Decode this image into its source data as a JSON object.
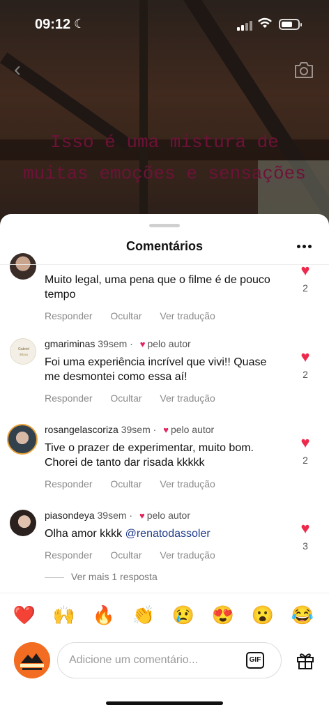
{
  "status_bar": {
    "time": "09:12",
    "moon": "☾"
  },
  "overlay_text": "Isso é uma mistura de muitas emoções e sensações",
  "sheet": {
    "title": "Comentários"
  },
  "comments": [
    {
      "username": "",
      "time": "",
      "author_label": "",
      "text": "Muito legal, uma pena que o filme é de pouco tempo",
      "likes": "2"
    },
    {
      "username": "gmariminas",
      "time": "39sem",
      "author_label": "pelo autor",
      "text": "Foi uma experiência incrível que vivi!! Quase me desmontei como essa aí!",
      "likes": "2"
    },
    {
      "username": "rosangelascoriza",
      "time": "39sem",
      "author_label": "pelo autor",
      "text": "Tive o prazer de experimentar,  muito bom. Chorei de tanto dar risada kkkkk",
      "likes": "2"
    },
    {
      "username": "piasondeya",
      "time": "39sem",
      "author_label": "pelo autor",
      "text": "Olha amor kkkk ",
      "mention": "@renatodassoler",
      "likes": "3"
    }
  ],
  "actions": {
    "reply": "Responder",
    "hide": "Ocultar",
    "translate": "Ver tradução"
  },
  "view_more": "Ver mais 1 resposta",
  "emojis": [
    "❤️",
    "🙌",
    "🔥",
    "👏",
    "😢",
    "😍",
    "😮",
    "😂"
  ],
  "input": {
    "placeholder": "Adicione um comentário...",
    "gif_label": "GIF"
  },
  "colors": {
    "accent_heart": "#ed2a4c",
    "mention": "#1f3b8a",
    "overlay_text": "#6e1238"
  }
}
